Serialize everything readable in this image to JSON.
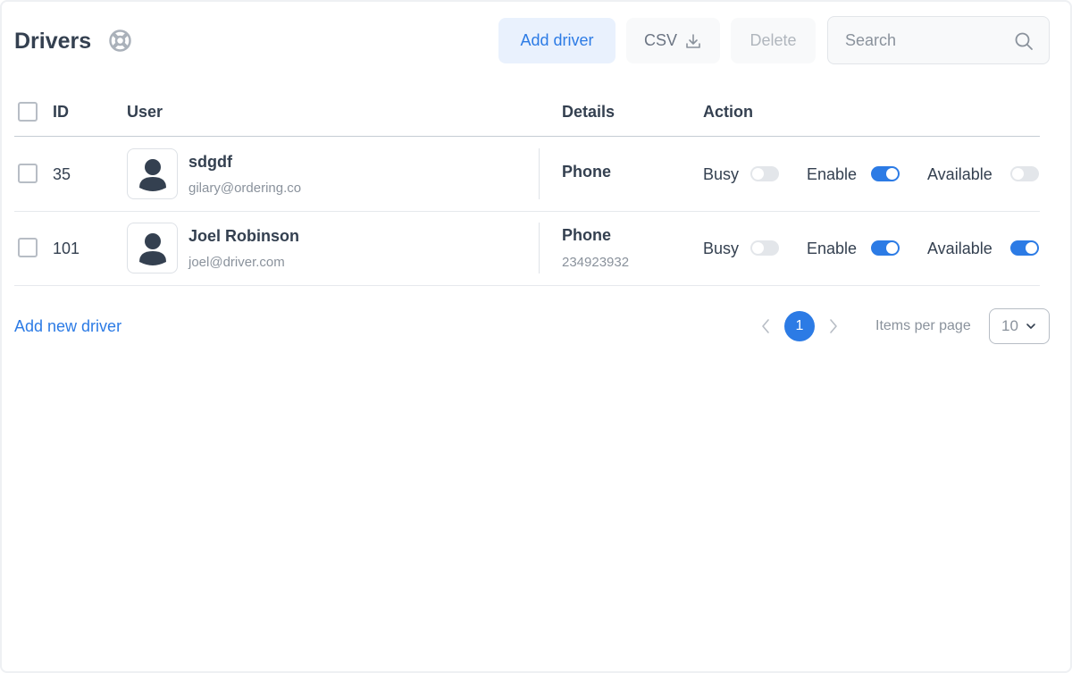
{
  "header": {
    "title": "Drivers",
    "help_icon": "lifebuoy-icon",
    "add_driver_label": "Add driver",
    "csv_label": "CSV",
    "csv_icon": "download-icon",
    "delete_label": "Delete",
    "search_placeholder": "Search",
    "search_icon": "search-icon"
  },
  "table": {
    "columns": [
      "ID",
      "User",
      "Details",
      "Action"
    ],
    "rows": [
      {
        "id": "35",
        "name": "sdgdf",
        "email": "gilary@ordering.co",
        "detail_label": "Phone",
        "detail_value": "",
        "busy_label": "Busy",
        "busy": false,
        "enable_label": "Enable",
        "enable": true,
        "available_label": "Available",
        "available": false
      },
      {
        "id": "101",
        "name": "Joel Robinson",
        "email": "joel@driver.com",
        "detail_label": "Phone",
        "detail_value": "234923932",
        "busy_label": "Busy",
        "busy": false,
        "enable_label": "Enable",
        "enable": true,
        "available_label": "Available",
        "available": true
      }
    ]
  },
  "footer": {
    "add_new_label": "Add new driver",
    "current_page": "1",
    "items_per_page_label": "Items per page",
    "items_per_page_value": "10"
  },
  "colors": {
    "accent": "#2c7be5",
    "text": "#344050",
    "muted": "#8a929c"
  }
}
